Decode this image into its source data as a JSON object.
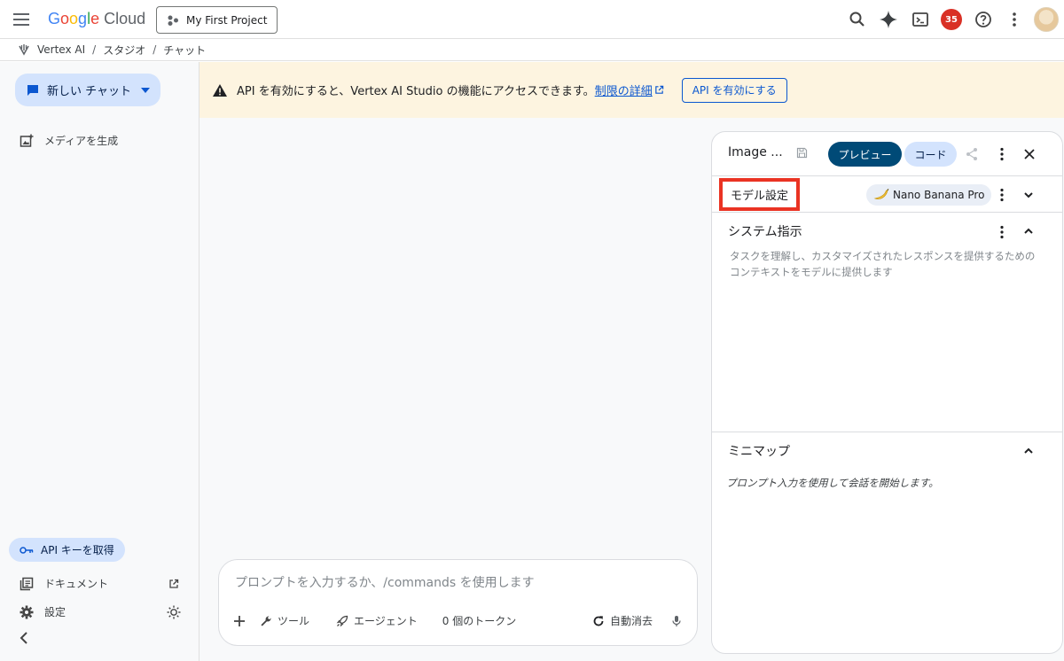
{
  "topbar": {
    "logo_parts": [
      "G",
      "o",
      "o",
      "g",
      "l",
      "e"
    ],
    "logo_suffix": " Cloud",
    "project_label": "My First Project",
    "notification_count": "35"
  },
  "breadcrumb": {
    "root": "Vertex AI",
    "items": [
      "スタジオ",
      "チャット"
    ],
    "separator": "/"
  },
  "sidebar": {
    "new_chat_label": "新しい チャット",
    "media_gen_label": "メディアを生成",
    "api_key_label": "API キーを取得",
    "docs_label": "ドキュメント",
    "settings_label": "設定"
  },
  "banner": {
    "message": "API を有効にすると、Vertex AI Studio の機能にアクセスできます。",
    "link_text": "制限の詳細",
    "button_label": "API を有効にする"
  },
  "prompt": {
    "placeholder": "プロンプトを入力するか、/commands を使用します",
    "tools_label": "ツール",
    "agent_label": "エージェント",
    "token_count": "0 個のトークン",
    "auto_clear_label": "自動消去"
  },
  "panel": {
    "title": "Image ...",
    "preview_label": "プレビュー",
    "code_label": "コード",
    "model_settings_label": "モデル設定",
    "model_name": "Nano Banana Pro",
    "system_title": "システム指示",
    "system_placeholder": "タスクを理解し、カスタマイズされたレスポンスを提供するためのコンテキストをモデルに提供します",
    "minimap_title": "ミニマップ",
    "minimap_text": "プロンプト入力を使用して会話を開始します。"
  },
  "colors": {
    "accent_blue": "#0b57d0",
    "chip_blue": "#d3e3fd",
    "preview_dark": "#004a77",
    "banner_bg": "#fdf4e0",
    "highlight_red": "#ea3323",
    "badge_red": "#d93025"
  }
}
